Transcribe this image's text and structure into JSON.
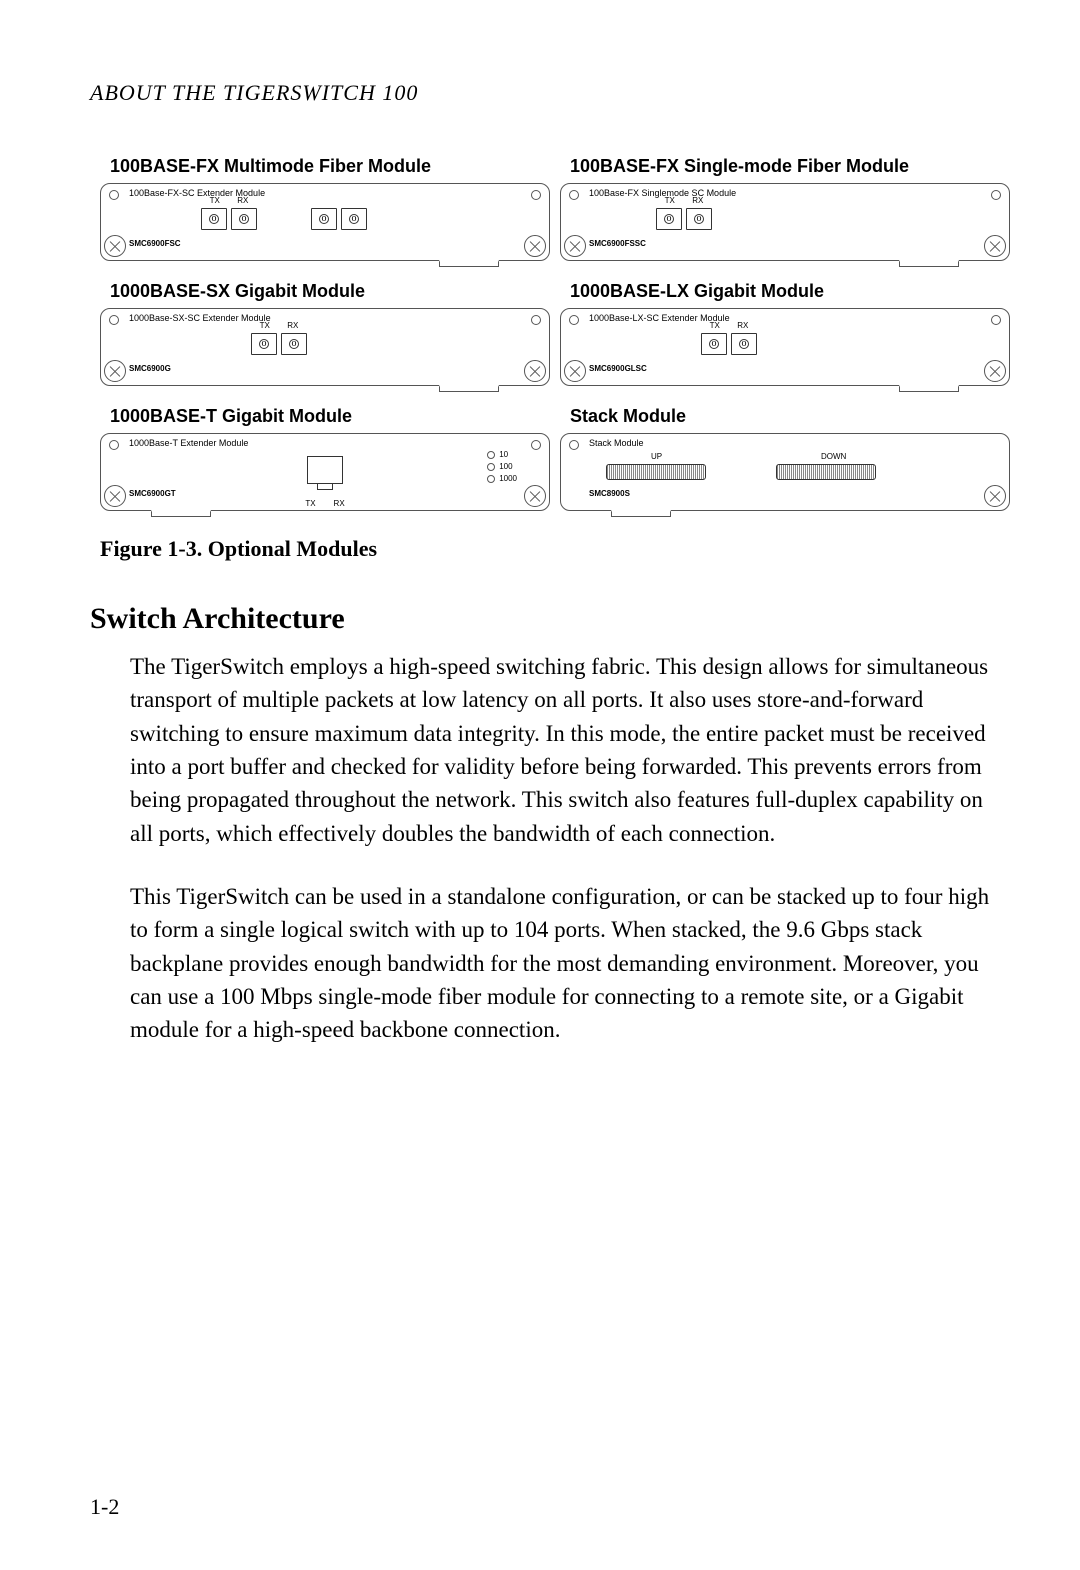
{
  "header": "ABOUT THE TIGERSWITCH 100",
  "modules": [
    {
      "title": "100BASE-FX Multimode Fiber Module",
      "subtitle": "100Base-FX-SC Extender Module",
      "model": "SMC6900FSC",
      "tx": "TX",
      "rx": "RX",
      "type": "dual_fiber_pair"
    },
    {
      "title": "100BASE-FX Single-mode Fiber Module",
      "subtitle": "100Base-FX Singlemode SC Module",
      "model": "SMC6900FSSC",
      "tx": "TX",
      "rx": "RX",
      "type": "single_fiber_pair"
    },
    {
      "title": "1000BASE-SX Gigabit Module",
      "subtitle": "1000Base-SX-SC Extender Module",
      "model": "SMC6900G",
      "tx": "TX",
      "rx": "RX",
      "type": "single_fiber_pair_offset"
    },
    {
      "title": "1000BASE-LX Gigabit Module",
      "subtitle": "1000Base-LX-SC Extender Module",
      "model": "SMC6900GLSC",
      "tx": "TX",
      "rx": "RX",
      "type": "single_fiber_pair_offset"
    },
    {
      "title": "1000BASE-T Gigabit Module",
      "subtitle": "1000Base-T Extender Module",
      "model": "SMC6900GT",
      "tx": "TX",
      "rx": "RX",
      "leds": [
        "10",
        "100",
        "1000"
      ],
      "type": "rj45"
    },
    {
      "title": "Stack Module",
      "subtitle": "Stack Module",
      "model": "SMC8900S",
      "up_label": "UP",
      "down_label": "DOWN",
      "type": "stack"
    }
  ],
  "figure_caption": "Figure 1-3.  Optional Modules",
  "section_heading": "Switch Architecture",
  "paragraph1": "The TigerSwitch employs a high-speed switching fabric. This design allows for simultaneous transport of multiple packets at low latency on all ports. It also uses store-and-forward switching to ensure maximum data integrity. In this mode, the entire packet must be received into a port buffer and checked for validity before being forwarded. This prevents errors from being propagated throughout the network. This switch also features full-duplex capability on all ports, which effectively doubles the bandwidth of each connection.",
  "paragraph2": "This TigerSwitch can be used in a standalone configuration, or can be stacked up to four high to form a single logical switch with up to 104 ports. When stacked, the 9.6 Gbps stack backplane provides enough bandwidth for the most demanding environment. Moreover, you can use a 100 Mbps single-mode fiber module for connecting to a remote site, or a Gigabit module for a high-speed backbone connection.",
  "page_number": "1-2"
}
